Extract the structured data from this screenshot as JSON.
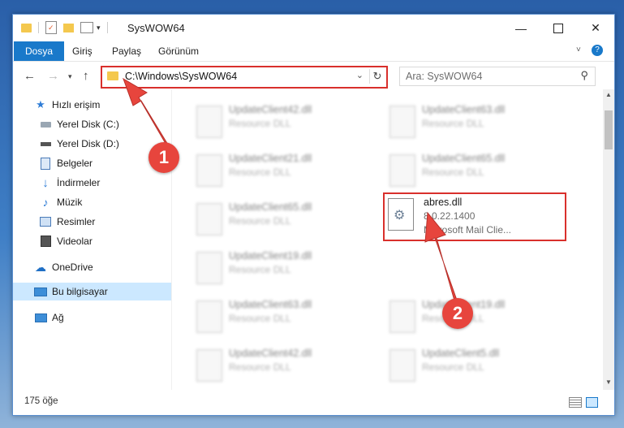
{
  "window": {
    "title": "SysWOW64"
  },
  "ribbon": {
    "tabs": [
      "Dosya",
      "Giriş",
      "Paylaş",
      "Görünüm"
    ]
  },
  "address": {
    "path": "C:\\Windows\\SysWOW64"
  },
  "search": {
    "placeholder": "Ara: SysWOW64"
  },
  "sidebar": {
    "items": [
      {
        "label": "Hızlı erişim",
        "icon": "star-icon"
      },
      {
        "label": "Yerel Disk (C:)",
        "icon": "drive-icon",
        "pinned": true
      },
      {
        "label": "Yerel Disk (D:)",
        "icon": "drive-icon"
      },
      {
        "label": "Belgeler",
        "icon": "document-icon",
        "pinned": true
      },
      {
        "label": "İndirmeler",
        "icon": "download-icon",
        "pinned": true
      },
      {
        "label": "Müzik",
        "icon": "music-icon",
        "pinned": true
      },
      {
        "label": "Resimler",
        "icon": "pictures-icon",
        "pinned": true
      },
      {
        "label": "Videolar",
        "icon": "video-icon",
        "pinned": true
      },
      {
        "label": "OneDrive",
        "icon": "cloud-icon"
      },
      {
        "label": "Bu bilgisayar",
        "icon": "computer-icon",
        "selected": true
      },
      {
        "label": "Ağ",
        "icon": "network-icon"
      }
    ]
  },
  "files": [
    {
      "name": "UpdateClient42.dll",
      "type": "Resource DLL"
    },
    {
      "name": "UpdateClient63.dll",
      "type": "Resource DLL"
    },
    {
      "name": "UpdateClient21.dll",
      "type": "Resource DLL"
    },
    {
      "name": "UpdateClient65.dll",
      "type": "Resource DLL"
    },
    {
      "name": "UpdateClient65.dll",
      "type": "Resource DLL"
    },
    {
      "name": "UpdateClient19.dll",
      "type": "Resource DLL"
    },
    {
      "name": "UpdateClient63.dll",
      "type": "Resource DLL"
    },
    {
      "name": "UpdateClient19.dll",
      "type": "Resource DLL"
    },
    {
      "name": "UpdateClient42.dll",
      "type": "Resource DLL"
    },
    {
      "name": "UpdateClient5.dll",
      "type": "Resource DLL"
    }
  ],
  "highlighted_file": {
    "name": "abres.dll",
    "version": "8.0.22.1400",
    "description": "Microsoft Mail Clie..."
  },
  "status": {
    "count": "175 öğe"
  },
  "annotations": {
    "badge1": "1",
    "badge2": "2",
    "accent": "#e7453d"
  }
}
